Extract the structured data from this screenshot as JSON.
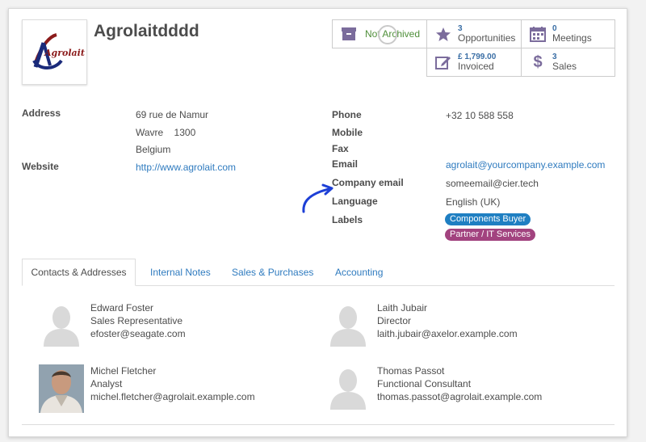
{
  "partner": {
    "name": "Agrolaitdddd",
    "logo_text": "Agrolait"
  },
  "stats": {
    "archive": {
      "label": "Not Archived",
      "icon": "archive-icon"
    },
    "opportunities": {
      "count": "3",
      "label": "Opportunities",
      "icon": "star-icon"
    },
    "meetings": {
      "count": "0",
      "label": "Meetings",
      "icon": "calendar-icon"
    },
    "invoiced": {
      "count": "£ 1,799.00",
      "label": "Invoiced",
      "icon": "edit-icon"
    },
    "sales": {
      "count": "3",
      "label": "Sales",
      "icon": "dollar-icon"
    }
  },
  "fields": {
    "address_label": "Address",
    "street": "69 rue de Namur",
    "city_zip": "Wavre    1300",
    "country": "Belgium",
    "website_label": "Website",
    "website": "http://www.agrolait.com",
    "phone_label": "Phone",
    "phone": "+32 10 588 558",
    "mobile_label": "Mobile",
    "fax_label": "Fax",
    "email_label": "Email",
    "email": "agrolait@yourcompany.example.com",
    "company_email_label": "Company email",
    "company_email": "someemail@cier.tech",
    "language_label": "Language",
    "language": "English (UK)",
    "labels_label": "Labels"
  },
  "tags": [
    {
      "text": "Components Buyer",
      "color": "#1f7fc2"
    },
    {
      "text": "Partner / IT Services",
      "color": "#a2437f"
    }
  ],
  "tabs": [
    {
      "label": "Contacts & Addresses"
    },
    {
      "label": "Internal Notes"
    },
    {
      "label": "Sales & Purchases"
    },
    {
      "label": "Accounting"
    }
  ],
  "contacts": [
    {
      "name": "Edward Foster",
      "role": "Sales Representative",
      "email": "efoster@seagate.com"
    },
    {
      "name": "Laith Jubair",
      "role": "Director",
      "email": "laith.jubair@axelor.example.com"
    },
    {
      "name": "Michel Fletcher",
      "role": "Analyst",
      "email": "michel.fletcher@agrolait.example.com"
    },
    {
      "name": "Thomas Passot",
      "role": "Functional Consultant",
      "email": "thomas.passot@agrolait.example.com"
    }
  ],
  "colors": {
    "accent": "#875a7b",
    "link": "#2f7bbf",
    "archive_green": "#4f8f3a",
    "annotation_blue": "#1d3fd6"
  }
}
